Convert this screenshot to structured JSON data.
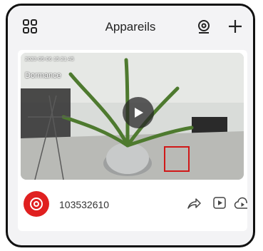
{
  "header": {
    "title": "Appareils",
    "left_icon": "grid-icon",
    "scan_icon": "scan-icon",
    "add_icon": "plus-icon"
  },
  "device": {
    "timestamp": "2023-05-06 15:21:45",
    "status": "Dormance",
    "name": "103532610",
    "brand_color": "#e02020",
    "actions": [
      "share-icon",
      "playback-icon",
      "cloud-play-icon"
    ]
  },
  "annotation": {
    "highlight_color": "#d01818"
  }
}
